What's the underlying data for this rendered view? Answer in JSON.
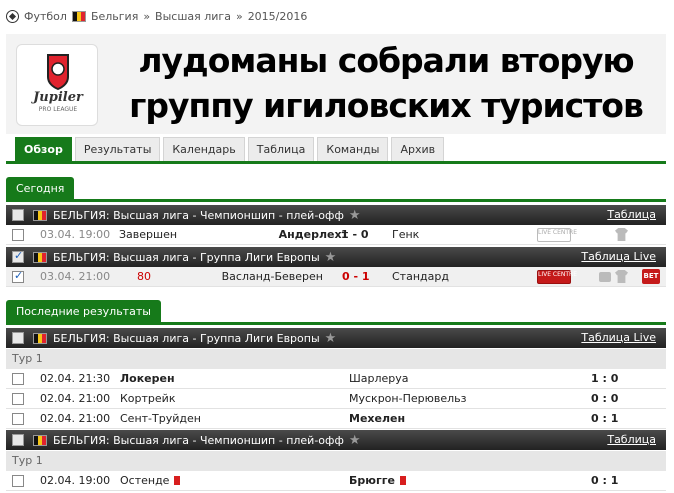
{
  "breadcrumb": {
    "sport": "Футбол",
    "country": "Бельгия",
    "sep": "»",
    "league": "Высшая лига",
    "season": "2015/2016"
  },
  "header": {
    "title_line1": "лудоманы собрали вторую",
    "title_line2": "группу игиловских туристов",
    "logo_text": "Jupiler",
    "logo_subtext": "PRO LEAGUE"
  },
  "tabs": [
    "Обзор",
    "Результаты",
    "Календарь",
    "Таблица",
    "Команды",
    "Архив"
  ],
  "today": {
    "label": "Сегодня",
    "league1": {
      "name": "БЕЛЬГИЯ: Высшая лига - Чемпионшип - плей-офф",
      "link": "Таблица"
    },
    "match1": {
      "time": "03.04. 19:00",
      "status": "Завершен",
      "home": "Андерлехт",
      "score": "1 - 0",
      "away": "Генк",
      "live": "LIVE CENTRE"
    },
    "league2": {
      "name": "БЕЛЬГИЯ: Высшая лига - Группа Лиги Европы",
      "link": "Таблица Live"
    },
    "match2": {
      "time": "03.04. 21:00",
      "minute": "80",
      "home": "Васланд-Беверен",
      "score": "0 - 1",
      "away": "Стандард",
      "live": "LIVE CENTRE",
      "bet": "BET"
    }
  },
  "results": {
    "label": "Последние результаты",
    "league1": {
      "name": "БЕЛЬГИЯ: Высшая лига - Группа Лиги Европы",
      "link": "Таблица Live",
      "round": "Тур 1"
    },
    "matches1": [
      {
        "time": "02.04. 21:30",
        "home": "Локерен",
        "away": "Шарлеруа",
        "score": "1 : 0"
      },
      {
        "time": "02.04. 21:00",
        "home": "Кортрейк",
        "away": "Мускрон-Перювельз",
        "score": "0 : 0"
      },
      {
        "time": "02.04. 21:00",
        "home": "Сент-Труйден",
        "away": "Мехелен",
        "score": "0 : 1"
      }
    ],
    "league2": {
      "name": "БЕЛЬГИЯ: Высшая лига - Чемпионшип - плей-офф",
      "link": "Таблица",
      "round": "Тур 1"
    },
    "matches2": [
      {
        "time": "02.04. 19:00",
        "home": "Остенде",
        "away": "Брюгге",
        "score": "0 : 1"
      }
    ]
  },
  "colors": {
    "accent": "#167a1a",
    "live": "#c51a1a"
  }
}
